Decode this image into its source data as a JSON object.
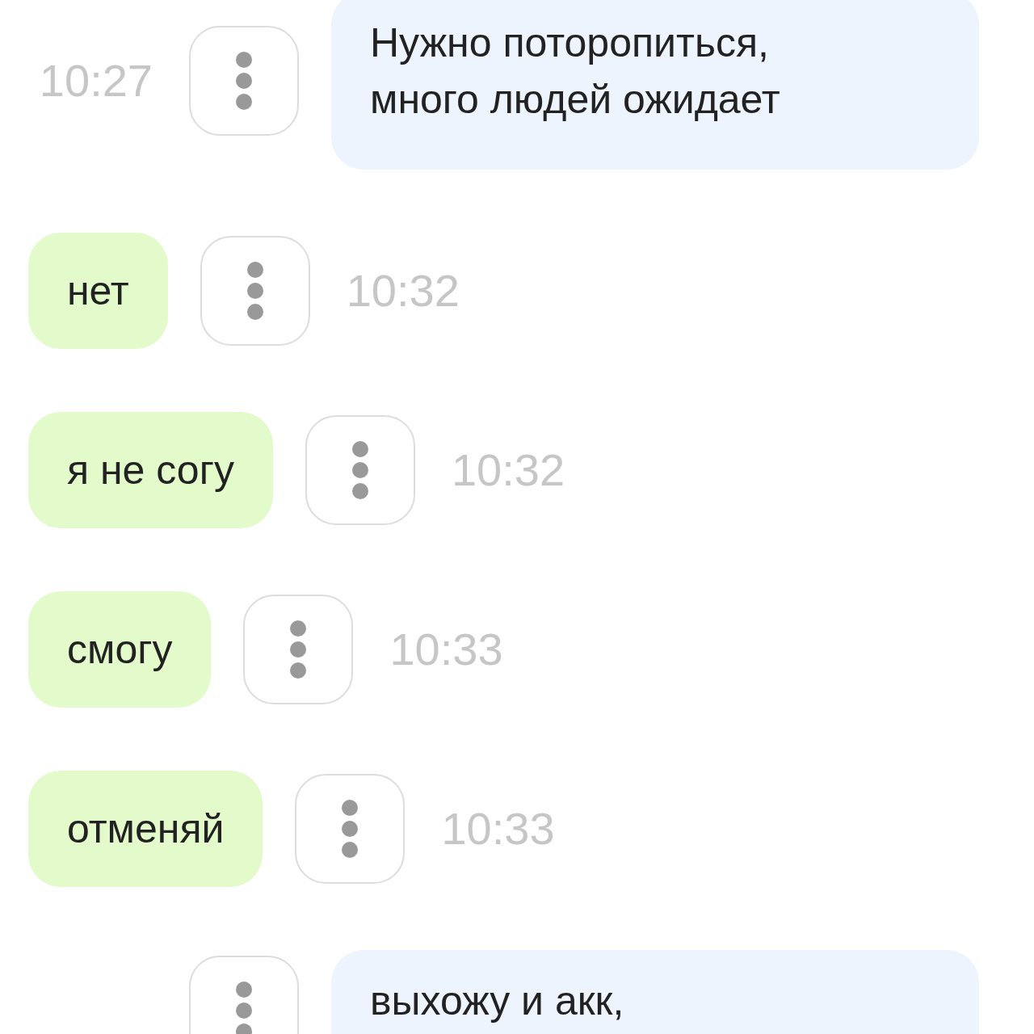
{
  "messages": [
    {
      "kind": "outgoing",
      "text": "Нужно поторопиться,\nмного людей ожидает",
      "time": "10:27"
    },
    {
      "kind": "incoming",
      "text": "нет",
      "time": "10:32"
    },
    {
      "kind": "incoming",
      "text": "я не согу",
      "time": "10:32"
    },
    {
      "kind": "incoming",
      "text": "смогу",
      "time": "10:33"
    },
    {
      "kind": "incoming",
      "text": "отменяй",
      "time": "10:33"
    },
    {
      "kind": "outgoing",
      "text": "выхожу и акк,"
    }
  ]
}
